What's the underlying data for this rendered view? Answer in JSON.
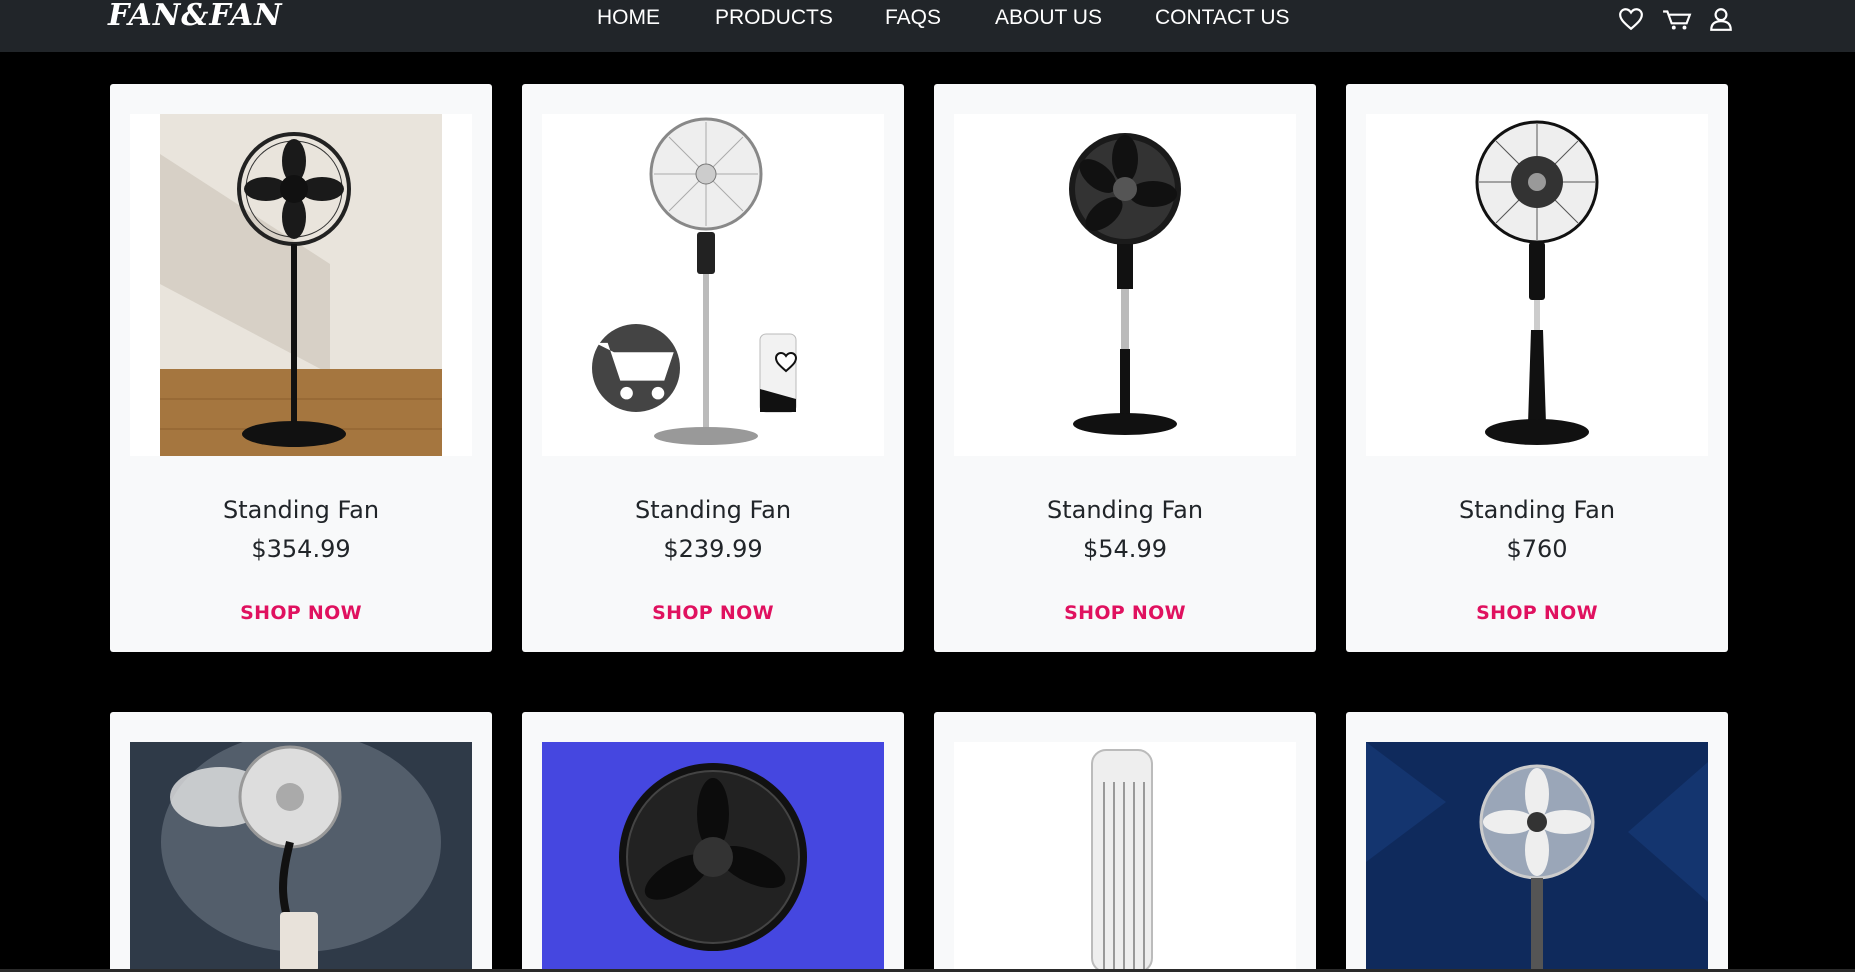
{
  "brand": {
    "logo": "FAN&FAN"
  },
  "nav": {
    "links": [
      "HOME",
      "PRODUCTS",
      "FAQS",
      "ABOUT US",
      "CONTACT US"
    ],
    "icons": [
      "heart-icon",
      "cart-icon",
      "user-icon"
    ]
  },
  "products": [
    {
      "name": "Standing Fan",
      "price": "$354.99",
      "cta": "SHOP NOW"
    },
    {
      "name": "Standing Fan",
      "price": "$239.99",
      "cta": "SHOP NOW"
    },
    {
      "name": "Standing Fan",
      "price": "$54.99",
      "cta": "SHOP NOW"
    },
    {
      "name": "Standing Fan",
      "price": "$760",
      "cta": "SHOP NOW"
    }
  ],
  "colors": {
    "navbar": "#212529",
    "page_bg": "#000000",
    "card_bg": "#f8f9fa",
    "accent": "#e0115f"
  }
}
